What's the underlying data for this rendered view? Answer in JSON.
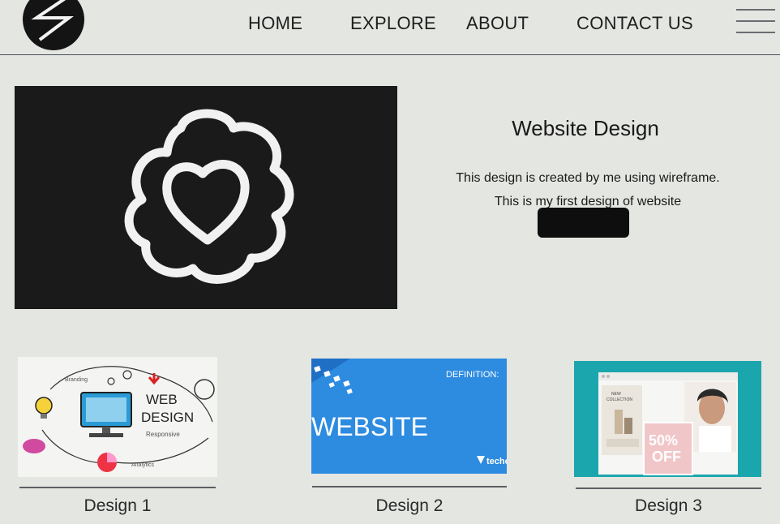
{
  "nav": {
    "logo": "lightning-logo",
    "items": [
      {
        "label": "HOME"
      },
      {
        "label": "EXPLORE"
      },
      {
        "label": "ABOUT"
      },
      {
        "label": "CONTACT US"
      }
    ],
    "menu_icon": "hamburger-icon"
  },
  "hero": {
    "image_icon": "flower-heart-logo",
    "title": "Website Design",
    "description_line1": "This design is created by me using wireframe.",
    "description_line2": "This is my first design of website"
  },
  "cards": [
    {
      "caption": "Design 1",
      "image_words": [
        "WEB",
        "DESIGN",
        "Responsive",
        "Analytics",
        "Branding"
      ]
    },
    {
      "caption": "Design 2",
      "image_words": [
        "DEFINITION:",
        "WEBSITE",
        "techo"
      ]
    },
    {
      "caption": "Design 3",
      "image_words": [
        "NEW",
        "COLLECTION",
        "50%",
        "OFF"
      ]
    }
  ],
  "colors": {
    "background": "#e4e6e2",
    "hero_image_bg": "#1a1a1a",
    "card2_bg": "#2d8be0",
    "card3_bg": "#1ba6ad"
  }
}
